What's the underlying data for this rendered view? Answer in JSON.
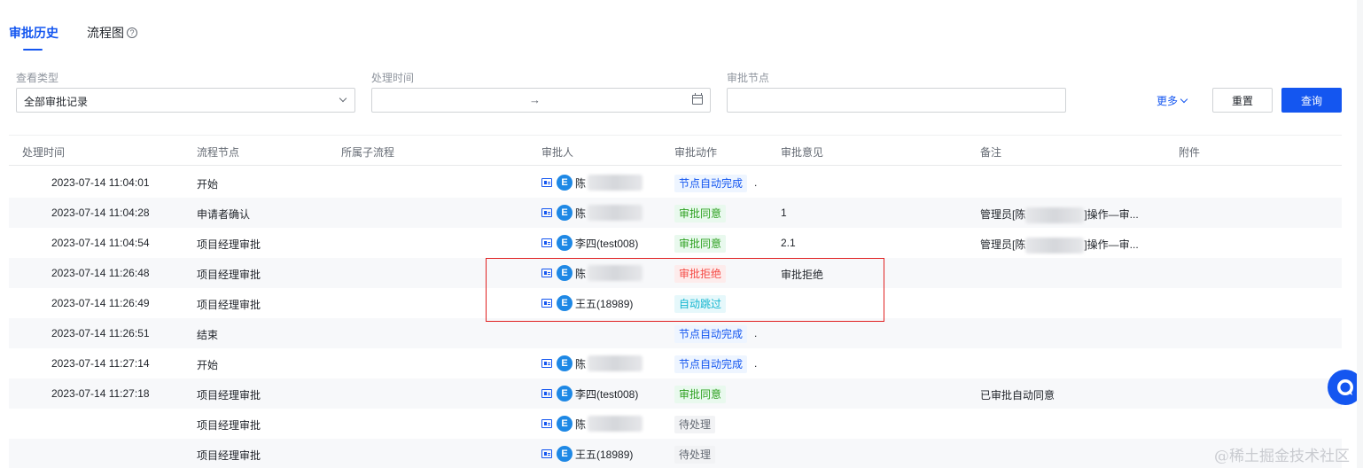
{
  "tabs": [
    {
      "label": "审批历史",
      "active": true
    },
    {
      "label": "流程图",
      "active": false
    }
  ],
  "filters": {
    "type_label": "查看类型",
    "type_value": "全部审批记录",
    "time_label": "处理时间",
    "time_separator": "→",
    "node_label": "审批节点",
    "node_value": "",
    "more_label": "更多",
    "reset_label": "重置",
    "query_label": "查询"
  },
  "table": {
    "columns": [
      "处理时间",
      "流程节点",
      "所属子流程",
      "审批人",
      "审批动作",
      "审批意见",
      "备注",
      "附件"
    ],
    "rows": [
      {
        "time": "2023-07-14 11:04:01",
        "node": "开始",
        "approver": "陈",
        "approver_blurred": true,
        "action": "节点自动完成",
        "action_type": "done",
        "dot": ".",
        "opinion": "",
        "remark": "",
        "remark_blurred": false,
        "remark_suffix": ""
      },
      {
        "time": "2023-07-14 11:04:28",
        "node": "申请者确认",
        "approver": "陈",
        "approver_blurred": true,
        "action": "审批同意",
        "action_type": "agree",
        "dot": "",
        "opinion": "1",
        "remark": "管理员[陈",
        "remark_blurred": true,
        "remark_suffix": "]操作—审..."
      },
      {
        "time": "2023-07-14 11:04:54",
        "node": "项目经理审批",
        "approver": "李四(test008)",
        "approver_blurred": false,
        "action": "审批同意",
        "action_type": "agree",
        "dot": "",
        "opinion": "2.1",
        "remark": "管理员[陈",
        "remark_blurred": true,
        "remark_suffix": "]操作—审..."
      },
      {
        "time": "2023-07-14 11:26:48",
        "node": "项目经理审批",
        "approver": "陈",
        "approver_blurred": true,
        "action": "审批拒绝",
        "action_type": "reject",
        "dot": "",
        "opinion": "审批拒绝",
        "remark": "",
        "remark_blurred": false,
        "remark_suffix": ""
      },
      {
        "time": "2023-07-14 11:26:49",
        "node": "项目经理审批",
        "approver": "王五(18989)",
        "approver_blurred": false,
        "action": "自动跳过",
        "action_type": "skip",
        "dot": "",
        "opinion": "",
        "remark": "",
        "remark_blurred": false,
        "remark_suffix": ""
      },
      {
        "time": "2023-07-14 11:26:51",
        "node": "结束",
        "approver": "",
        "approver_blurred": false,
        "action": "节点自动完成",
        "action_type": "done",
        "dot": ".",
        "opinion": "",
        "remark": "",
        "remark_blurred": false,
        "remark_suffix": ""
      },
      {
        "time": "2023-07-14 11:27:14",
        "node": "开始",
        "approver": "陈",
        "approver_blurred": true,
        "action": "节点自动完成",
        "action_type": "done",
        "dot": ".",
        "opinion": "",
        "remark": "",
        "remark_blurred": false,
        "remark_suffix": ""
      },
      {
        "time": "2023-07-14 11:27:18",
        "node": "项目经理审批",
        "approver": "李四(test008)",
        "approver_blurred": false,
        "action": "审批同意",
        "action_type": "agree",
        "dot": "",
        "opinion": "",
        "remark": "已审批自动同意",
        "remark_blurred": false,
        "remark_suffix": ""
      },
      {
        "time": "",
        "node": "项目经理审批",
        "approver": "陈",
        "approver_blurred": true,
        "action": "待处理",
        "action_type": "pending",
        "dot": "",
        "opinion": "",
        "remark": "",
        "remark_blurred": false,
        "remark_suffix": ""
      },
      {
        "time": "",
        "node": "项目经理审批",
        "approver": "王五(18989)",
        "approver_blurred": false,
        "action": "待处理",
        "action_type": "pending",
        "dot": "",
        "opinion": "",
        "remark": "",
        "remark_blurred": false,
        "remark_suffix": ""
      }
    ]
  },
  "avatar_letter": "E",
  "watermark": "@稀土掘金技术社区",
  "colors": {
    "primary": "#1456f0",
    "agree": "#2ea121",
    "reject": "#f54a45",
    "skip": "#12b5cf",
    "highlight": "#e02020"
  }
}
